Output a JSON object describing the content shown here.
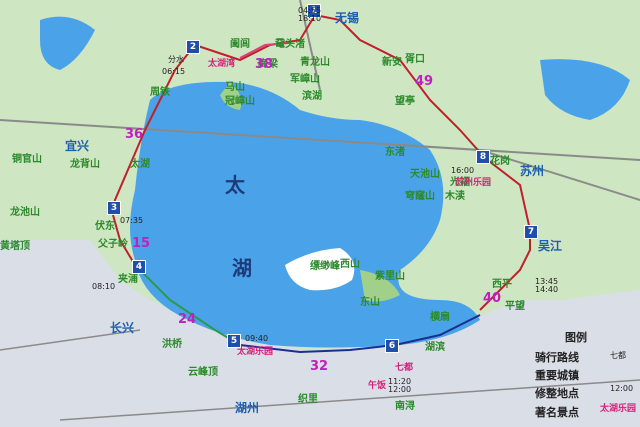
{
  "lake": {
    "chars": [
      "太",
      "湖"
    ]
  },
  "cities": [
    {
      "name": "无锡",
      "cls": "place-big"
    },
    {
      "name": "苏州",
      "cls": "place-big"
    },
    {
      "name": "湖州",
      "cls": "place-big"
    },
    {
      "name": "长兴",
      "cls": "place-big"
    },
    {
      "name": "宜兴",
      "cls": "place-big"
    },
    {
      "name": "吴江",
      "cls": "place-big"
    }
  ],
  "places": [
    "胥口",
    "周铁",
    "马山",
    "冠嶂山",
    "滨湖",
    "新安",
    "望亭",
    "东渚",
    "木渎",
    "天池山",
    "穹窿山",
    "光福",
    "东山",
    "西山",
    "缥缈峰",
    "横扇",
    "湖滨",
    "南浔",
    "织里",
    "太湖",
    "夹浦",
    "父子岭",
    "伏东",
    "龙池山",
    "龙背山",
    "铜官山",
    "黄塔顶",
    "阖闾",
    "鼋头渚",
    "青龙山",
    "军嶂山",
    "梅梁",
    "洪桥",
    "云峰顶",
    "西平",
    "紫里山",
    "花岗",
    "平望"
  ],
  "distances": [
    "36",
    "38",
    "49",
    "24",
    "32",
    "40",
    "15"
  ],
  "checkpoints": [
    {
      "num": "1",
      "time": "04:55\n18:10"
    },
    {
      "num": "2",
      "time": "06:15"
    },
    {
      "name": "分水",
      "time": ""
    },
    {
      "num": "3",
      "time": "07:35"
    },
    {
      "num": "4",
      "time": "08:10"
    },
    {
      "num": "5",
      "time": "09:40"
    },
    {
      "num": "6",
      "time": "11:20\n12:00"
    },
    {
      "num": "7",
      "time": "13:45\n14:40"
    },
    {
      "num": "8",
      "time": "16:00"
    }
  ],
  "pois": [
    "太湖湾",
    "太湖乐园",
    "苏州乐园",
    "七都",
    "午饭"
  ],
  "legend": {
    "title": "图例",
    "rows": [
      "骑行路线",
      "重要城镇",
      "修整地点",
      "著名景点"
    ],
    "sample_town": "七都",
    "sample_time": "12:00",
    "sample_poi": "太湖乐园"
  },
  "colors": {
    "water": "#4aa3e8",
    "land": "#cfe6c2",
    "route_red": "#c0202a",
    "route_blue": "#1a2f8f",
    "route_green": "#2c9a4a",
    "road": "#8a8a8a"
  }
}
